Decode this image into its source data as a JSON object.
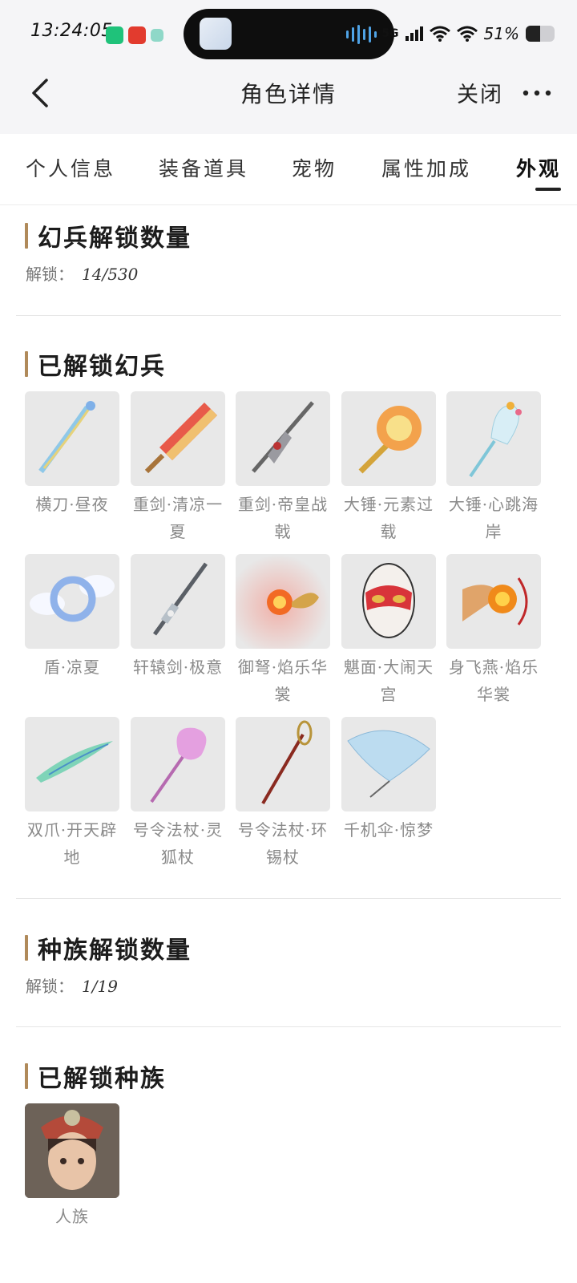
{
  "status_bar": {
    "time": "13:24:05",
    "network": "5G",
    "battery": "51%",
    "battery_level": 0.51
  },
  "nav": {
    "title": "角色详情",
    "close_label": "关闭",
    "back_icon": "chevron-left-icon",
    "more_icon": "more-dots-icon"
  },
  "tabs": [
    {
      "label": "个人信息"
    },
    {
      "label": "装备道具"
    },
    {
      "label": "宠物"
    },
    {
      "label": "属性加成"
    },
    {
      "label": "外观"
    }
  ],
  "sections": {
    "weapon_count": {
      "title": "幻兵解锁数量",
      "unlock_label": "解锁：",
      "unlock_value": "14/530"
    },
    "weapons": {
      "title": "已解锁幻兵",
      "items": [
        {
          "name": "横刀·昼夜"
        },
        {
          "name": "重剑·清凉一夏"
        },
        {
          "name": "重剑·帝皇战戟"
        },
        {
          "name": "大锤·元素过载"
        },
        {
          "name": "大锤·心跳海岸"
        },
        {
          "name": "盾·凉夏"
        },
        {
          "name": "轩辕剑·极意"
        },
        {
          "name": "御弩·焰乐华裳"
        },
        {
          "name": "魌面·大闹天宫"
        },
        {
          "name": "身飞燕·焰乐华裳"
        },
        {
          "name": "双爪·开天辟地"
        },
        {
          "name": "号令法杖·灵狐杖"
        },
        {
          "name": "号令法杖·环锡杖"
        },
        {
          "name": "千机伞·惊梦"
        }
      ]
    },
    "race_count": {
      "title": "种族解锁数量",
      "unlock_label": "解锁：",
      "unlock_value": "1/19"
    },
    "races": {
      "title": "已解锁种族",
      "items": [
        {
          "name": "人族"
        }
      ]
    }
  },
  "colors": {
    "accent_bar": "#b08a5a",
    "card_bg": "#e8e8e8",
    "caption": "#8a8a8a"
  }
}
